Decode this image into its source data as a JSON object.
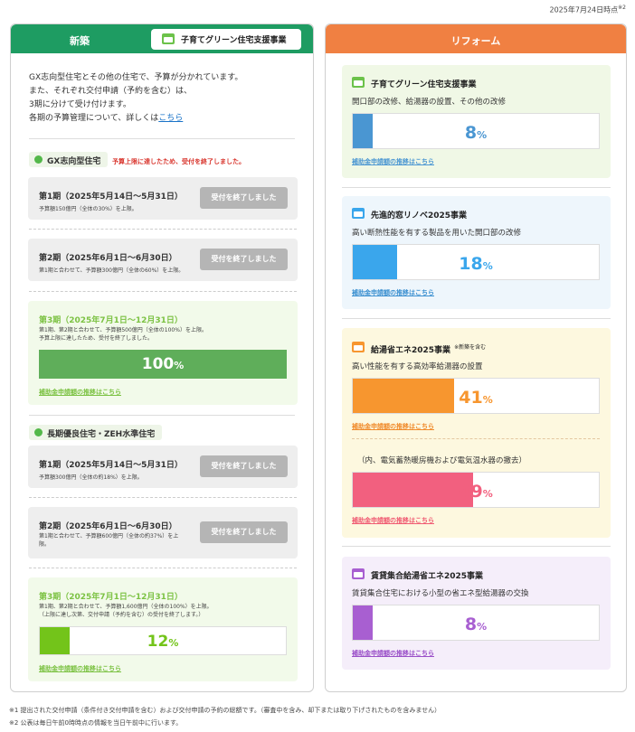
{
  "as_of": {
    "date": "2025年7月24日時点",
    "note": "※2"
  },
  "left": {
    "title": "新築",
    "tab_label": "子育てグリーン住宅支援事業",
    "intro": [
      "GX志向型住宅とその他の住宅で、予算が分かれています。",
      "また、それぞれ交付申請（予約を含む）は、",
      "3期に分けて受け付けます。"
    ],
    "intro_last": "各期の予算管理について、詳しくは",
    "intro_link": "こちら",
    "gx": {
      "label": "GX志向型住宅",
      "notice": "予算上限に達したため、受付を終了しました。",
      "p1": {
        "title": "第1期（2025年5月14日〜5月31日）",
        "sub": "予算額150億円（全体の30%）を上限。",
        "button": "受付を終了しました"
      },
      "p2": {
        "title": "第2期（2025年6月1日〜6月30日）",
        "sub": "第1期と合わせて、予算額300億円（全体の60%）を上限。",
        "button": "受付を終了しました"
      },
      "p3": {
        "title": "第3期（2025年7月1日〜12月31日）",
        "sub1": "第1期、第2期と合わせて、予算額500億円（全体の100%）を上限。",
        "sub2": "予算上限に達したため、受付を終了しました。",
        "pct": "100",
        "unit": "%",
        "progress": 100,
        "link": "補助金申請額の推移はこちら"
      }
    },
    "zeh": {
      "label": "長期優良住宅・ZEH水準住宅",
      "p1": {
        "title": "第1期（2025年5月14日〜5月31日）",
        "sub": "予算額300億円（全体の約18%）を上限。",
        "button": "受付を終了しました"
      },
      "p2": {
        "title": "第2期（2025年6月1日〜6月30日）",
        "sub1": "第1期と合わせて、予算額600億円（全体の約37%）を上",
        "sub2": "限。",
        "button": "受付を終了しました"
      },
      "p3": {
        "title": "第3期（2025年7月1日〜12月31日）",
        "sub1": "第1期、第2期と合わせて、予算額1,600億円（全体の100%）を上限。",
        "sub2": "（上限に達し次第、交付申請（予約を含む）の受付を終了します。）",
        "pct": "12",
        "unit": "%",
        "progress": 12,
        "link": "補助金申請額の推移はこちら"
      }
    }
  },
  "right": {
    "title": "リフォーム",
    "cards": [
      {
        "title": "子育てグリーン住宅支援事業",
        "desc": "開口部の改修、給湯器の設置、その他の改修",
        "pct": "8",
        "unit": "%",
        "progress": 8,
        "link": "補助金申請額の推移はこちら",
        "color": "#4a96d2"
      },
      {
        "title": "先進的窓リノベ2025事業",
        "desc": "高い断熱性能を有する製品を用いた開口部の改修",
        "pct": "18",
        "unit": "%",
        "progress": 18,
        "link": "補助金申請額の推移はこちら",
        "color": "#3aa6ec"
      },
      {
        "title": "給湯省エネ2025事業",
        "note": "※新築を含む",
        "desc": "高い性能を有する高効率給湯器の設置",
        "pct": "41",
        "unit": "%",
        "progress": 41,
        "link": "補助金申請額の推移はこちら",
        "color": "#f7962f"
      },
      {
        "desc": "（内、電気蓄熱暖房機および電気温水器の撤去）",
        "pct": "49",
        "unit": "%",
        "progress": 49,
        "link": "補助金申請額の推移はこちら",
        "color": "#f2607f"
      },
      {
        "title": "賃貸集合給湯省エネ2025事業",
        "desc": "賃貸集合住宅における小型の省エネ型給湯器の交換",
        "pct": "8",
        "unit": "%",
        "progress": 8,
        "link": "補助金申請額の推移はこちら",
        "color": "#a85fd1"
      }
    ]
  },
  "footnotes": [
    "※1  提出された交付申請（条件付き交付申請を含む）および交付申請の予約の総額です。（審査中を含み、却下または取り下げされたものを含みません）",
    "※2  公表は毎日午前0時時点の情報を当日午前中に行います。"
  ]
}
